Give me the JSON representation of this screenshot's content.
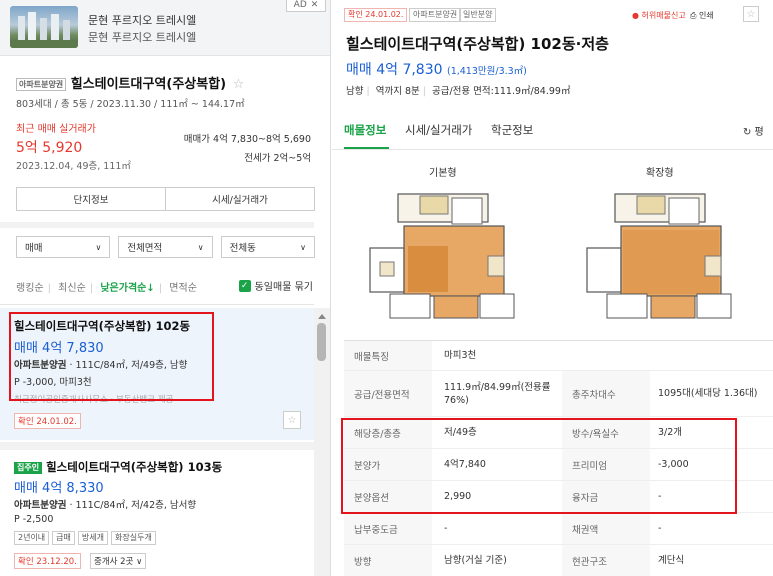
{
  "ad": {
    "title": "문현 푸르지오 트레시엘",
    "subtitle": "문현 푸르지오 트레시엘",
    "tag": "AD",
    "close": "✕"
  },
  "complex": {
    "badge": "아파트분양권",
    "name": "힐스테이트대구역(주상복합)",
    "meta": "803세대 / 총 5동 / 2023.11.30 / 111㎡ ~ 144.17㎡",
    "recent_label": "최근 매매 실거래가",
    "recent_price": "5억 5,920",
    "recent_date": "2023.12.04, 49층, 111㎡",
    "trade_range": "매매가 4억 7,830~8억 5,690",
    "jeonse_range": "전세가 2억~5억",
    "btn_info": "단지정보",
    "btn_real": "시세/실거래가"
  },
  "filters": {
    "type": "매매",
    "area": "전체면적",
    "building": "전체동"
  },
  "sorts": {
    "ranking": "랭킹순",
    "latest": "최신순",
    "low_price": "낮은가격순↓",
    "area": "면적순",
    "group_label": "동일매물 묶기"
  },
  "listings": [
    {
      "title": "힐스테이트대구역(주상복합) 102동",
      "price": "매매 4억 7,830",
      "spec_type": "아파트분양권",
      "spec": " · 111C/84㎡, 저/49층, 남향",
      "sub": "P -3,000, 마피3천",
      "faded": "최근정이공인중개사사무소 · 부동산뱅크 제공",
      "confirm": "확인 24.01.02."
    },
    {
      "tag": "집주인",
      "title": "힐스테이트대구역(주상복합) 103동",
      "price": "매매 4억 8,330",
      "spec_type": "아파트분양권",
      "spec": " · 111C/84㎡, 저/42층, 남서향",
      "sub": "P -2,500",
      "tags": [
        "2년이내",
        "급매",
        "방세개",
        "화장실두개"
      ],
      "confirm": "확인 23.12.20.",
      "agents": "중개사 2곳 ∨"
    }
  ],
  "detail": {
    "tag_confirm": "확인 24.01.02.",
    "tag_type": "아파트분양권",
    "tag_sale": "일반분양",
    "report": "● 허위매물신고",
    "print": "⎙ 인쇄",
    "title": "힐스테이트대구역(주상복합) 102동·저층",
    "price": "매매 4억 7,830",
    "price_sub": "(1,413만원/3.3㎡)",
    "meta_dir": "남향",
    "meta_station": "역까지 8분",
    "meta_area": "공급/전용 면적:111.9㎡/84.99㎡",
    "tabs": [
      "매물정보",
      "시세/실거래가",
      "학군정보"
    ],
    "refresh": "↻ 평",
    "fp_basic": "기본형",
    "fp_ext": "확장형"
  },
  "info_table": [
    {
      "k": "매물특징",
      "v": "마피3천"
    },
    {
      "k": "공급/전용면적",
      "v": "111.9㎡/84.99㎡(전용률76%)",
      "k2": "총주차대수",
      "v2": "1095대(세대당 1.36대)"
    },
    {
      "k": "해당층/총층",
      "v": "저/49층",
      "k2": "방수/욕실수",
      "v2": "3/2개"
    },
    {
      "k": "분양가",
      "v": "4억7,840",
      "k2": "프리미엄",
      "v2": "-3,000"
    },
    {
      "k": "분양옵션",
      "v": "2,990",
      "k2": "융자금",
      "v2": "-"
    },
    {
      "k": "납부중도금",
      "v": "-",
      "k2": "채권액",
      "v2": "-"
    },
    {
      "k": "방향",
      "v": "남향(거실 기준)",
      "k2": "현관구조",
      "v2": "계단식"
    }
  ]
}
